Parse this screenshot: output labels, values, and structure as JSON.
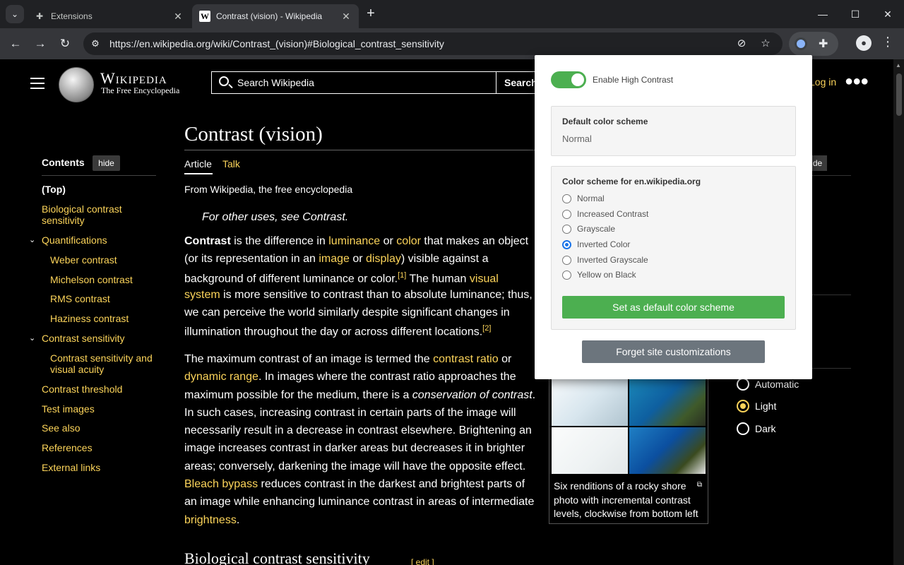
{
  "browser": {
    "tabs": [
      {
        "title": "Extensions",
        "icon": "puzzle-icon"
      },
      {
        "title": "Contrast (vision) - Wikipedia",
        "icon": "wikipedia-w-icon"
      }
    ],
    "url": "https://en.wikipedia.org/wiki/Contrast_(vision)#Biological_contrast_sensitivity"
  },
  "wiki": {
    "wordmark": "Wikipedia",
    "tagline_logo": "The Free Encyclopedia",
    "search_placeholder": "Search Wikipedia",
    "search_button": "Search",
    "login": "Log in",
    "contents_title": "Contents",
    "hide_label": "hide",
    "toc": [
      {
        "label": "(Top)"
      },
      {
        "label": "Biological contrast sensitivity"
      },
      {
        "label": "Quantifications"
      },
      {
        "label": "Weber contrast"
      },
      {
        "label": "Michelson contrast"
      },
      {
        "label": "RMS contrast"
      },
      {
        "label": "Haziness contrast"
      },
      {
        "label": "Contrast sensitivity"
      },
      {
        "label": "Contrast sensitivity and visual acuity"
      },
      {
        "label": "Contrast threshold"
      },
      {
        "label": "Test images"
      },
      {
        "label": "See also"
      },
      {
        "label": "References"
      },
      {
        "label": "External links"
      }
    ],
    "title": "Contrast (vision)",
    "tab_article": "Article",
    "tab_talk": "Talk",
    "from": "From Wikipedia, the free encyclopedia",
    "hatnote": "For other uses, see Contrast.",
    "h2": "Biological contrast sensitivity",
    "h2_edit": "[ edit ]",
    "right_hide": "de",
    "color_options": [
      {
        "label": "Automatic",
        "selected": false
      },
      {
        "label": "Light",
        "selected": true
      },
      {
        "label": "Dark",
        "selected": false
      }
    ],
    "caption": "Six renditions of a rocky shore photo with incremental contrast levels, clockwise from bottom left"
  },
  "popup": {
    "enable_label": "Enable High Contrast",
    "enabled": true,
    "default_title": "Default color scheme",
    "default_value": "Normal",
    "site_title": "Color scheme for en.wikipedia.org",
    "schemes": [
      {
        "label": "Normal",
        "selected": false
      },
      {
        "label": "Increased Contrast",
        "selected": false
      },
      {
        "label": "Grayscale",
        "selected": false
      },
      {
        "label": "Inverted Color",
        "selected": true
      },
      {
        "label": "Inverted Grayscale",
        "selected": false
      },
      {
        "label": "Yellow on Black",
        "selected": false
      }
    ],
    "set_default_button": "Set as default color scheme",
    "forget_button": "Forget site customizations"
  },
  "colors": {
    "link": "#fcd45a",
    "toggle_on": "#4caf50",
    "button_gray": "#6c757d",
    "radio_selected": "#1a73e8"
  }
}
